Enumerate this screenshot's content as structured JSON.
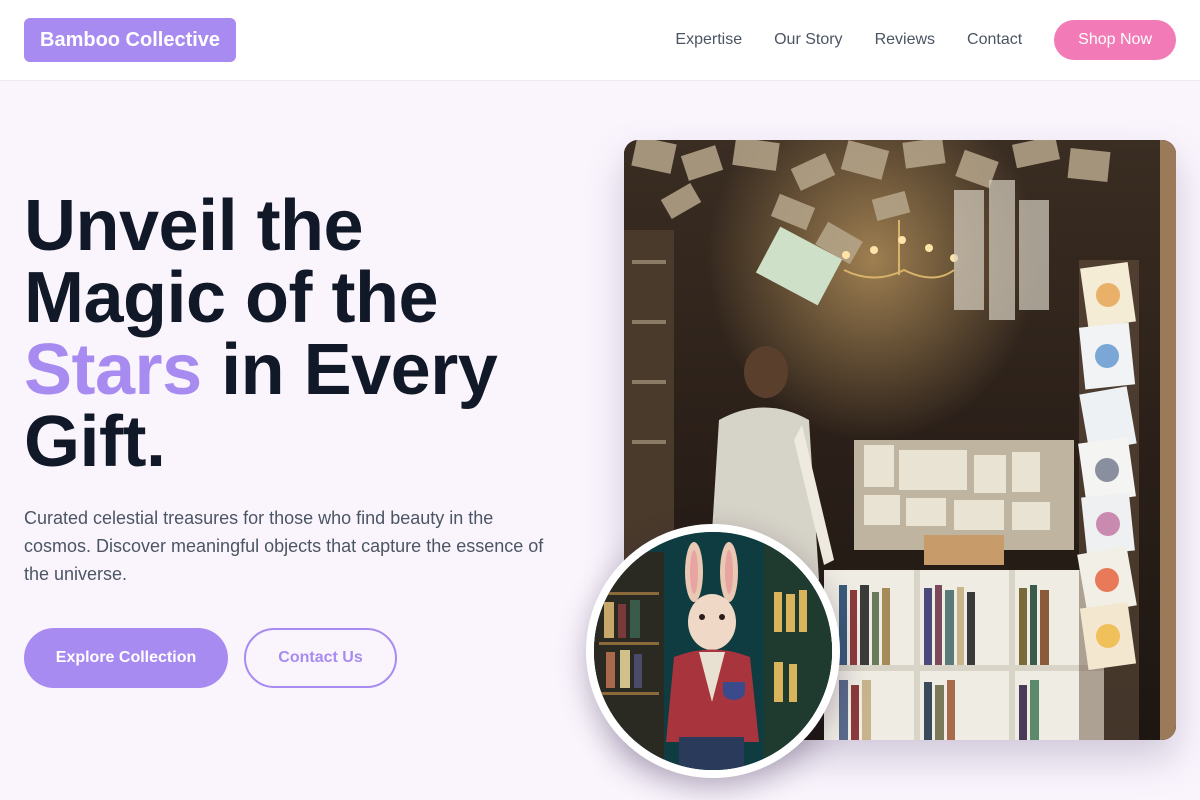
{
  "brand": {
    "name": "Bamboo Collective"
  },
  "nav": {
    "links": [
      "Expertise",
      "Our Story",
      "Reviews",
      "Contact"
    ],
    "cta": "Shop Now"
  },
  "hero": {
    "headline_part1": "Unveil the Magic of the",
    "headline_accent": "Stars",
    "headline_part2": "in Every Gift.",
    "subtext": "Curated celestial treasures for those who find beauty in the cosmos. Discover meaningful objects that capture the essence of the universe.",
    "primary_button": "Explore Collection",
    "secondary_button": "Contact Us"
  },
  "colors": {
    "brand_purple": "#a88bf1",
    "pink": "#f27ab6",
    "heading": "#111827",
    "body": "#4b5563",
    "page_bg": "#faf5fd"
  }
}
